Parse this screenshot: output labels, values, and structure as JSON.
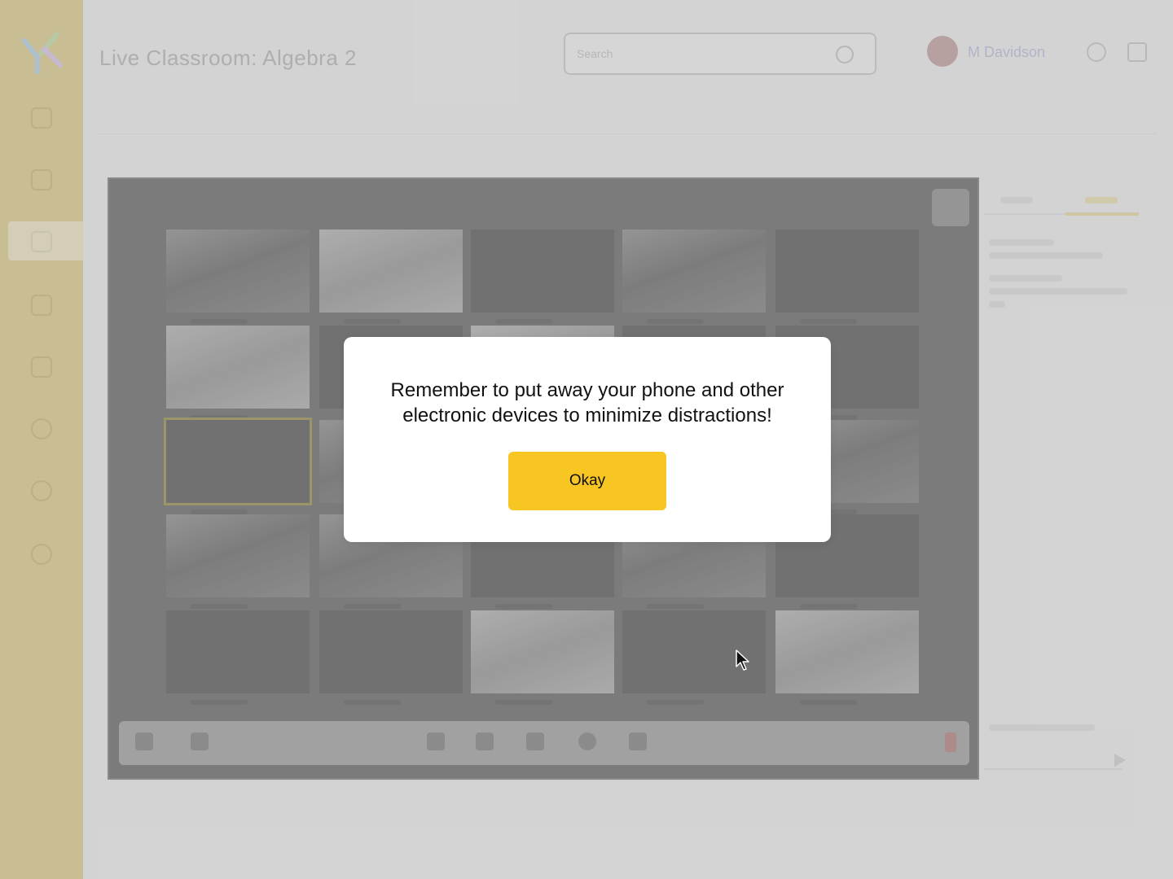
{
  "app": {
    "title": "Live Classroom: Algebra 2",
    "search_placeholder": "Search",
    "user_name": "M Davidson"
  },
  "dialog": {
    "message": "Remember to put away your phone and other electronic devices to minimize distractions!",
    "confirm_label": "Okay"
  },
  "colors": {
    "sidebar": "#d9cc98",
    "accent": "#f7c622",
    "modal_bg": "#ffffff"
  },
  "icons": {
    "sidebar": [
      "home-icon",
      "calendar-icon",
      "classroom-icon",
      "chat-icon",
      "people-icon",
      "chart-icon",
      "settings-icon",
      "help-icon"
    ],
    "toolbar": [
      "mic-icon",
      "camera-icon",
      "hand-icon",
      "chat-icon",
      "screen-share-icon",
      "settings-icon",
      "more-icon",
      "end-call-icon"
    ],
    "top": [
      "bell-icon",
      "message-icon"
    ]
  }
}
